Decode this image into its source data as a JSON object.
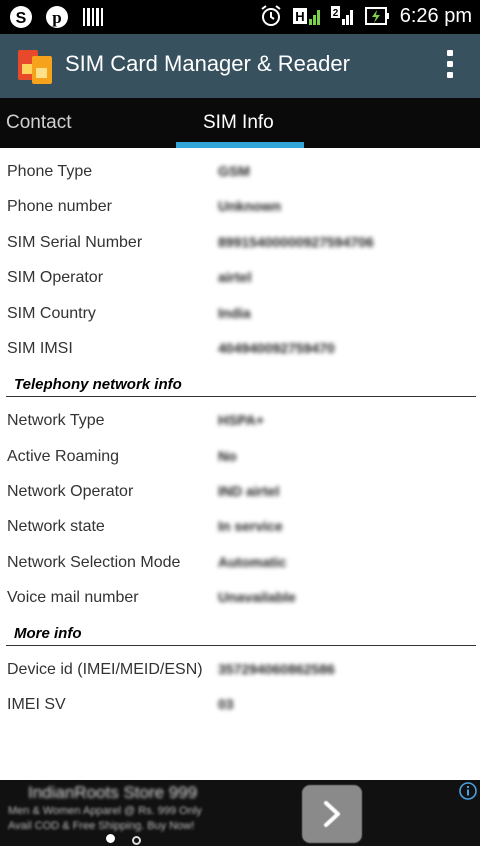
{
  "status_bar": {
    "time": "6:26 pm",
    "left_icons": [
      "skype-icon",
      "pinterest-icon",
      "barcode-icon"
    ],
    "right_icons": [
      "alarm-icon",
      "hspa-signal-icon",
      "sim2-signal-icon",
      "battery-charging-icon"
    ]
  },
  "app_bar": {
    "title": "SIM Card Manager & Reader",
    "logo_icon": "sim-cards-logo-icon",
    "menu_icon": "overflow-menu-icon"
  },
  "tabs": [
    {
      "label": "Contact",
      "selected": false
    },
    {
      "label": "SIM Info",
      "selected": true
    }
  ],
  "sim_info": {
    "rows": [
      {
        "label": "Phone Type",
        "value": "GSM"
      },
      {
        "label": "Phone number",
        "value": "Unknown"
      },
      {
        "label": "SIM Serial Number",
        "value": "89915400000927594706"
      },
      {
        "label": "SIM Operator",
        "value": "airtel"
      },
      {
        "label": "SIM Country",
        "value": "India"
      },
      {
        "label": "SIM IMSI",
        "value": "404940092759470"
      }
    ]
  },
  "telephony": {
    "title": "Telephony network info",
    "rows": [
      {
        "label": "Network Type",
        "value": "HSPA+"
      },
      {
        "label": "Active Roaming",
        "value": "No"
      },
      {
        "label": "Network Operator",
        "value": "IND airtel"
      },
      {
        "label": "Network state",
        "value": "In service"
      },
      {
        "label": "Network Selection Mode",
        "value": "Automatic"
      },
      {
        "label": "Voice mail number",
        "value": "Unavailable"
      }
    ]
  },
  "more_info": {
    "title": "More info",
    "rows": [
      {
        "label": "Device id (IMEI/MEID/ESN)",
        "value": "357294060862586"
      },
      {
        "label": "IMEI SV",
        "value": "03"
      }
    ]
  },
  "ad": {
    "title": "IndianRoots Store 999",
    "line1": "Men & Women Apparel @ Rs. 999 Only",
    "line2": "Avail COD & Free Shipping. Buy Now!",
    "arrow_icon": "chevron-right-icon",
    "info_icon": "info-icon",
    "colors": {
      "background": "#111111",
      "info_blue": "#4aa3df"
    }
  },
  "colors": {
    "app_bar": "#37515f",
    "tab_bar": "#0a0a0a",
    "tab_indicator": "#34a5d9"
  }
}
